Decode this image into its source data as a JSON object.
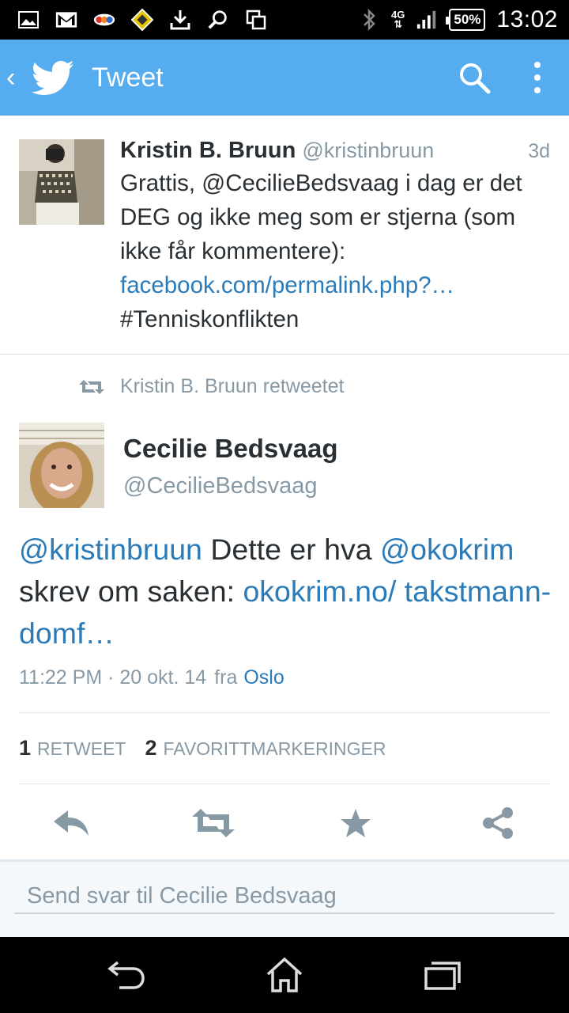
{
  "status_bar": {
    "network": "4G",
    "battery": "50%",
    "time": "13:02"
  },
  "app_bar": {
    "title": "Tweet"
  },
  "tweet_top": {
    "name": "Kristin B. Bruun",
    "handle": "@kristinbruun",
    "time": "3d",
    "text_1": "Grattis, @CecilieBedsvaag i dag er det DEG og ikke meg som er stjerna (som ikke får kommentere): ",
    "link": "facebook.com/permalink.php?…",
    "hashtag": "#Tenniskonflikten"
  },
  "retweet_context": "Kristin B. Bruun retweetet",
  "tweet_main": {
    "name": "Cecilie Bedsvaag",
    "handle": "@CecilieBedsvaag",
    "mention_1": "@kristinbruun",
    "text_1": " Dette er hva ",
    "mention_2": "@okokrim",
    "text_2": " skrev om saken: ",
    "link": "okokrim.no/ takstmann-domf…",
    "timestamp": "11:22 PM · 20 okt. 14",
    "via": "fra",
    "place": "Oslo"
  },
  "stats": {
    "retweets_count": "1",
    "retweets_label": "RETWEET",
    "favorites_count": "2",
    "favorites_label": "FAVORITTMARKERINGER"
  },
  "reply": {
    "placeholder": "Send svar til Cecilie Bedsvaag"
  },
  "colors": {
    "twitter_blue": "#55acee",
    "link_blue": "#2b7bb9",
    "muted_gray": "#8899a6",
    "text_dark": "#292f33"
  }
}
